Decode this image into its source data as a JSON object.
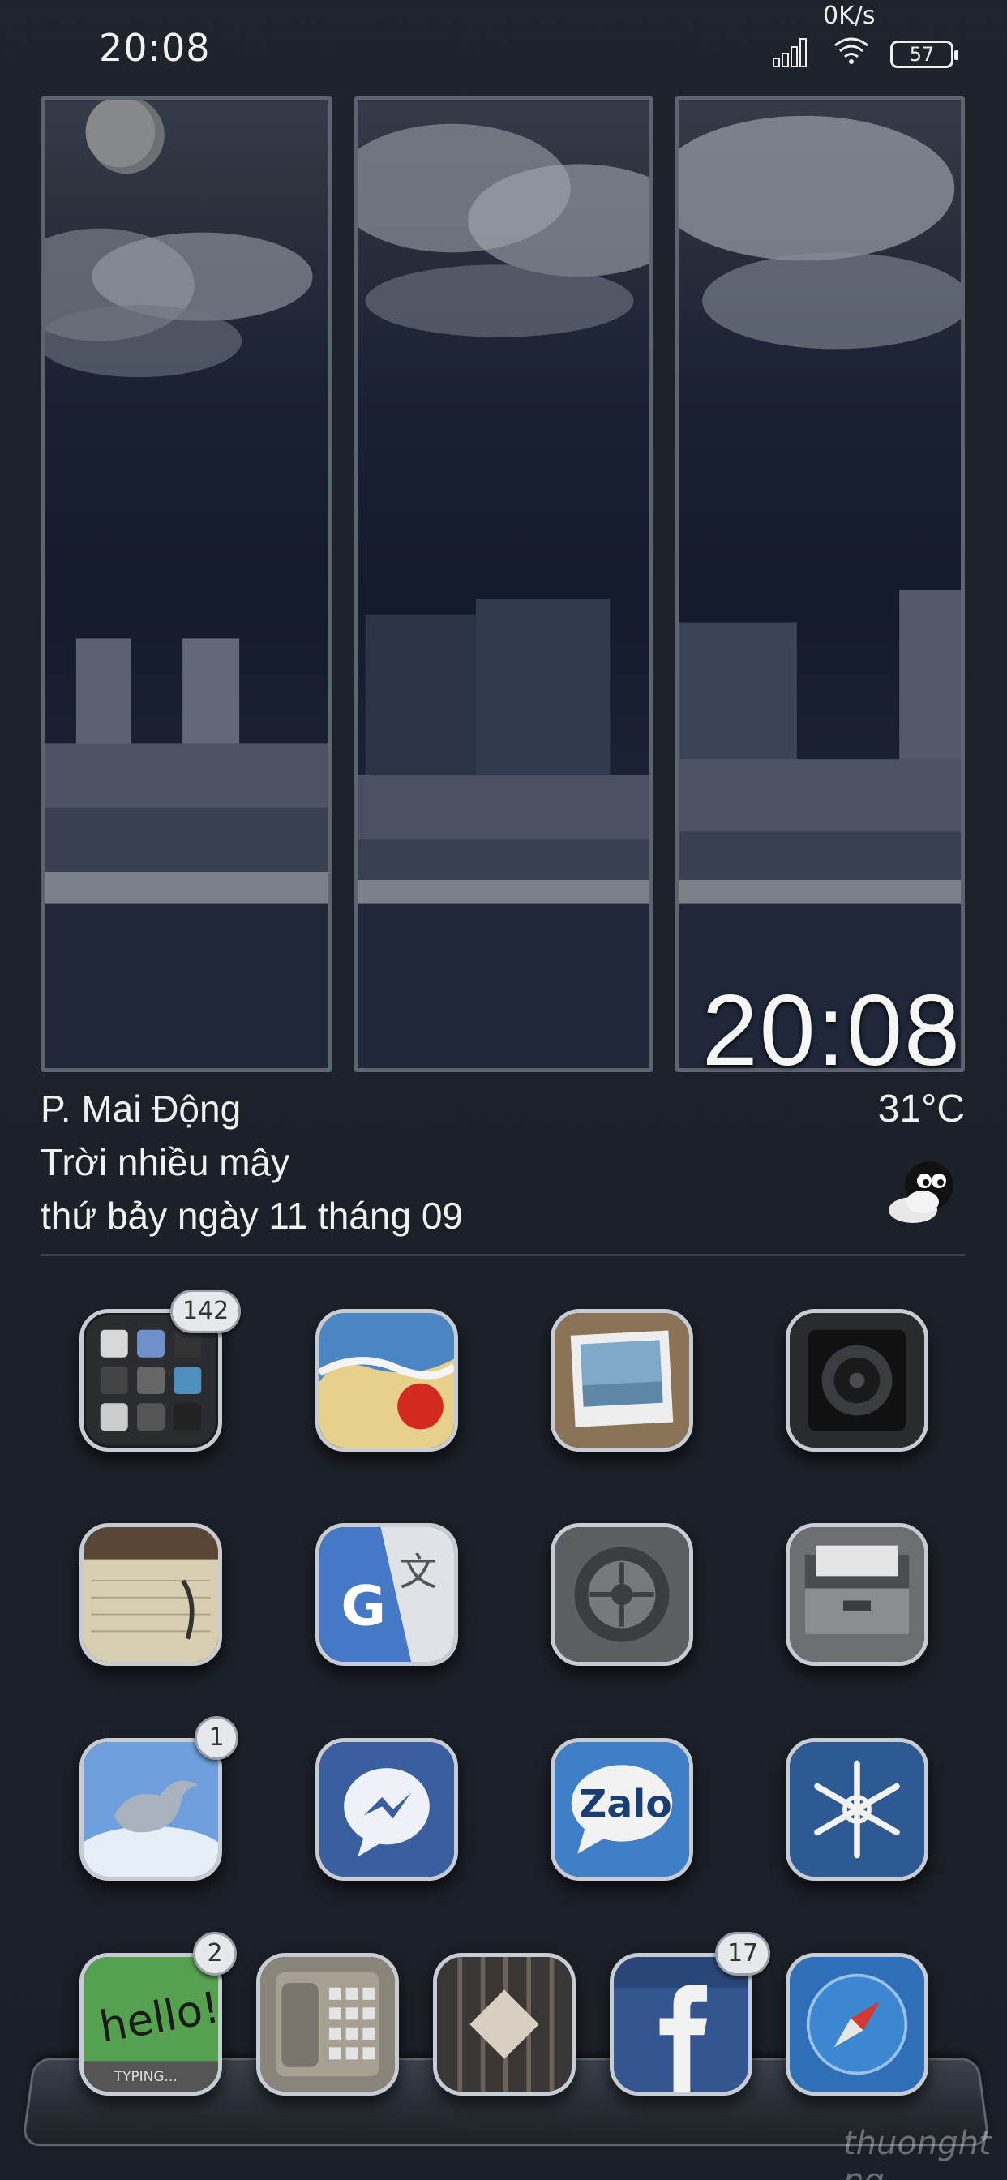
{
  "status_bar": {
    "time": "20:08",
    "net_speed": "0K/s",
    "battery": "57"
  },
  "widget": {
    "clock": "20:08",
    "location": "P. Mai Động",
    "condition": "Trời nhiều mây",
    "date": "thứ bảy ngày 11 tháng 09",
    "temperature": "31°C"
  },
  "apps": [
    {
      "name": "folder",
      "badge": "142"
    },
    {
      "name": "photos-beach",
      "badge": ""
    },
    {
      "name": "photo-frame",
      "badge": ""
    },
    {
      "name": "camera",
      "badge": ""
    },
    {
      "name": "notes",
      "badge": ""
    },
    {
      "name": "google-translate",
      "badge": ""
    },
    {
      "name": "settings",
      "badge": ""
    },
    {
      "name": "files",
      "badge": ""
    },
    {
      "name": "twitter",
      "badge": "1"
    },
    {
      "name": "messenger",
      "badge": ""
    },
    {
      "name": "zalo",
      "badge": ""
    },
    {
      "name": "snowflake",
      "badge": ""
    }
  ],
  "dock": [
    {
      "name": "hello-typing",
      "badge": "2",
      "label": "hello!",
      "sub": "TYPING..."
    },
    {
      "name": "phone",
      "badge": ""
    },
    {
      "name": "cydia",
      "badge": ""
    },
    {
      "name": "facebook",
      "badge": "17"
    },
    {
      "name": "safari",
      "badge": ""
    }
  ],
  "zalo_label": "Zalo",
  "watermark": "thuonght ng"
}
